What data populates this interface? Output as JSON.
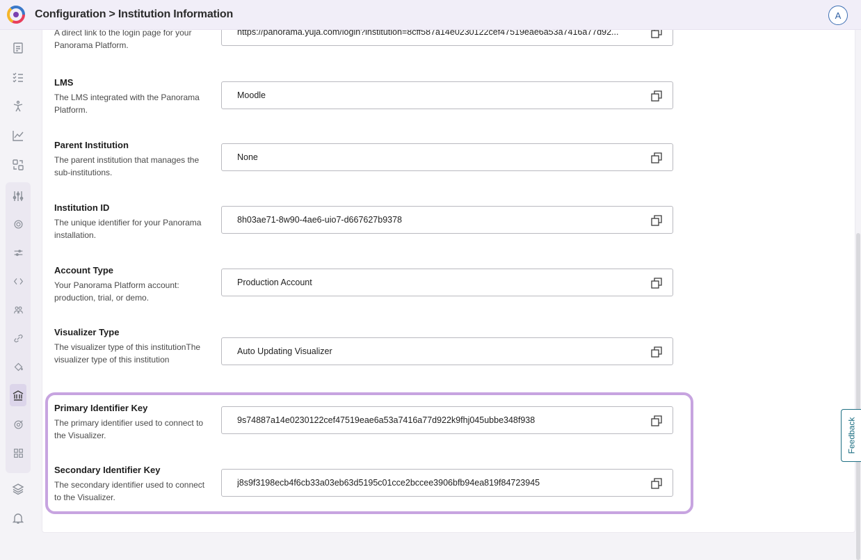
{
  "header": {
    "breadcrumb": "Configuration > Institution Information",
    "avatar_initial": "A"
  },
  "sidebar": {
    "icons": [
      "document-icon",
      "checklist-icon",
      "accessibility-icon",
      "analytics-icon",
      "scan-icon",
      "settings-sliders-icon",
      "gear-icon",
      "tune-icon",
      "code-icon",
      "users-icon",
      "link-icon",
      "paint-bucket-icon",
      "institution-icon",
      "target-icon",
      "grid-icon",
      "layers-icon",
      "bell-icon"
    ],
    "active": "institution-icon"
  },
  "rows": [
    {
      "label": "",
      "description": "A direct link to the login page for your Panorama Platform.",
      "value": "https://panorama.yuja.com/login?institution=8cff587a14e0230122cef47519eae6a53a7416a77d92..."
    },
    {
      "label": "LMS",
      "description": "The LMS integrated with the Panorama Platform.",
      "value": "Moodle"
    },
    {
      "label": "Parent Institution",
      "description": "The parent institution that manages the sub-institutions.",
      "value": "None"
    },
    {
      "label": "Institution ID",
      "description": "The unique identifier for your Panorama installation.",
      "value": "8h03ae71-8w90-4ae6-uio7-d667627b9378"
    },
    {
      "label": "Account Type",
      "description": "Your Panorama Platform account: production, trial, or demo.",
      "value": "Production Account"
    },
    {
      "label": "Visualizer Type",
      "description": "The visualizer type of this institutionThe visualizer type of this institution",
      "value": "Auto Updating Visualizer"
    },
    {
      "label": "Primary Identifier Key",
      "description": "The primary identifier used to connect to the Visualizer.",
      "value": "9s74887a14e0230122cef47519eae6a53a7416a77d922k9fhj045ubbe348f938"
    },
    {
      "label": "Secondary Identifier Key",
      "description": "The secondary identifier used to connect to the Visualizer.",
      "value": "j8s9f3198ecb4f6cb33a03eb63d5195c01cce2bccee3906bfb94ea819f84723945"
    }
  ],
  "feedback_label": "Feedback",
  "colors": {
    "highlight": "#c7a4e0",
    "accent": "#3d6fb3",
    "feedback": "#1d6f83"
  }
}
